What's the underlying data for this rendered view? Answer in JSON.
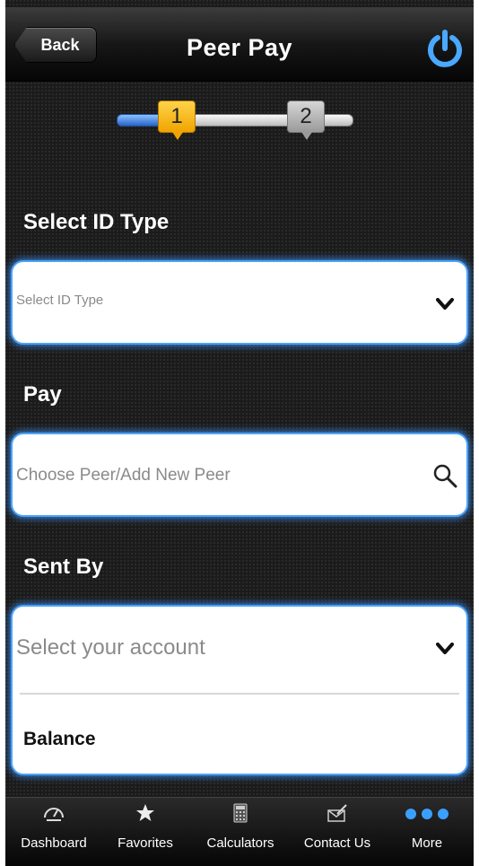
{
  "header": {
    "back_label": "Back",
    "title": "Peer Pay",
    "power_icon": "power-icon"
  },
  "stepper": {
    "steps": [
      "1",
      "2"
    ],
    "current_step": 1,
    "active_color": "#f0a400",
    "inactive_color": "#9a9a9a"
  },
  "form": {
    "id_type": {
      "label": "Select ID Type",
      "value": "Select ID Type",
      "icon": "chevron-down-icon"
    },
    "pay": {
      "label": "Pay",
      "placeholder": "Choose Peer/Add New Peer",
      "icon": "search-icon"
    },
    "sent_by": {
      "label": "Sent By",
      "value": "Select your account",
      "icon": "chevron-down-icon",
      "balance_label": "Balance"
    }
  },
  "tabbar": {
    "tabs": [
      {
        "label": "Dashboard",
        "icon": "dashboard-icon"
      },
      {
        "label": "Favorites",
        "icon": "star-icon"
      },
      {
        "label": "Calculators",
        "icon": "calculator-icon"
      },
      {
        "label": "Contact Us",
        "icon": "mail-icon"
      },
      {
        "label": "More",
        "icon": "more-icon"
      }
    ],
    "more_dots_color": "#3aa0ff"
  },
  "accent_color": "#4aa3ff"
}
